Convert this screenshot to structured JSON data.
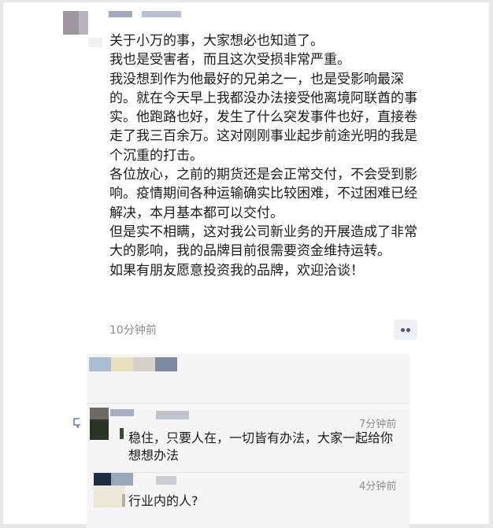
{
  "post": {
    "lines": [
      "关于小万的事，大家想必也知道了。",
      "我也是受害者，而且这次受损非常严重。",
      "我没想到作为他最好的兄弟之一，也是受影响最深的。就在今天早上我都没办法接受他离境阿联酋的事实。他跑路也好，发生了什么突发事件也好，直接卷走了我三百余万。这对刚刚事业起步前途光明的我是个沉重的打击。",
      "各位放心，之前的期货还是会正常交付，不会受到影响。疫情期间各种运输确实比较困难，不过困难已经解决，本月基本都可以交付。",
      "但是实不相瞒，这对我公司新业务的开展造成了非常大的影响，我的品牌目前很需要资金维持运转。",
      "如果有朋友愿意投资我的品牌，欢迎洽谈！"
    ],
    "time": "10分钟前",
    "more_icon": "more-dots-icon"
  },
  "comments": [
    {
      "text": "稳住，只要人在，一切皆有办法，大家一起给你想想办法",
      "time": "7分钟前"
    },
    {
      "text": "行业内的人?",
      "time": "4分钟前"
    }
  ],
  "colors": {
    "background": "#e8e8e8",
    "card": "#ffffff",
    "comment_panel": "#f5f5f5",
    "meta_text": "#8d8d8d",
    "more_button": "#eef0f5"
  }
}
